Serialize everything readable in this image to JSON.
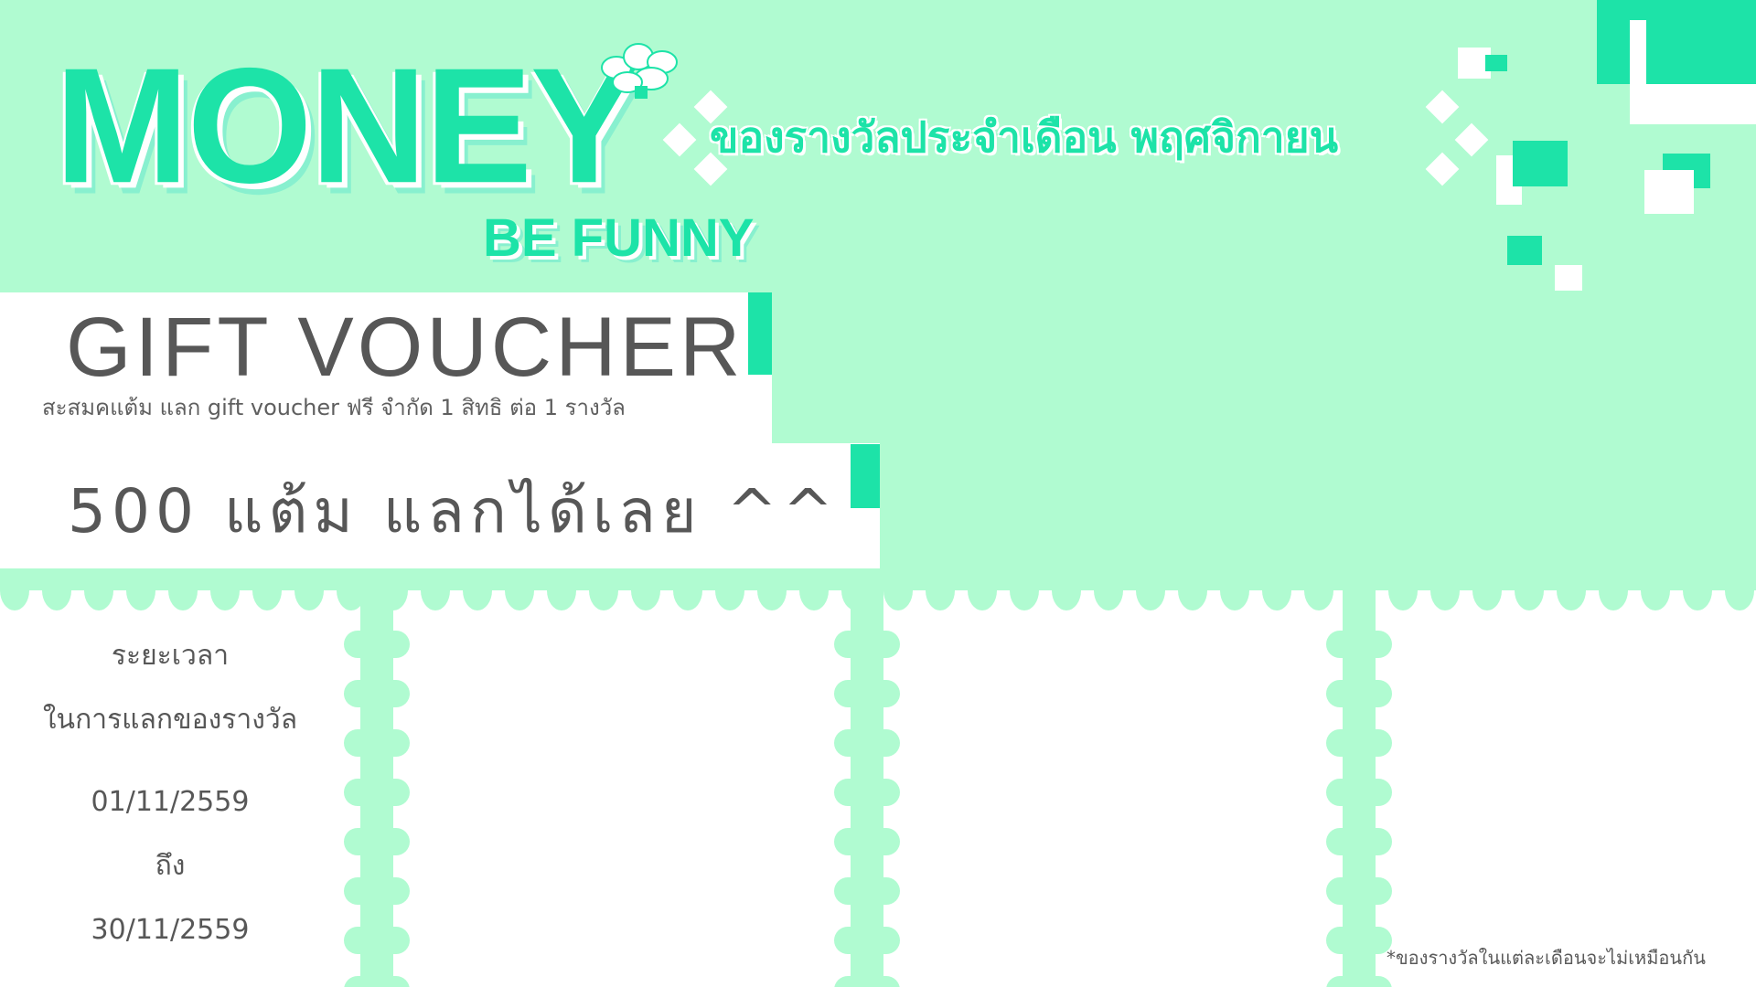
{
  "brand": {
    "title": "MONEY",
    "tagline": "BE FUNNY"
  },
  "header": {
    "monthly_title": "ของรางวัลประจำเดือน พฤศจิกายน"
  },
  "voucher": {
    "title": "GIFT VOUCHER",
    "subtitle": "สะสมคแต้ม แลก gift voucher ฟรี จำกัด 1 สิทธิ ต่อ 1 รางวัล",
    "points_text": "500 แต้ม แลกได้เลย ^^"
  },
  "period": {
    "label_1": "ระยะเวลา",
    "label_2": "ในการแลกของรางวัล",
    "start_date": "01/11/2559",
    "to_label": "ถึง",
    "end_date": "30/11/2559"
  },
  "footnote": "*ของรางวัลในแต่ละเดือนจะไม่เหมือนกัน",
  "colors": {
    "background": "#b0fbd1",
    "accent": "#1de3a8",
    "text": "#575757",
    "panel": "#ffffff"
  },
  "icons": {
    "flower": "flower-icon",
    "diamond": "diamond-icon"
  }
}
